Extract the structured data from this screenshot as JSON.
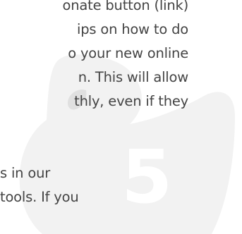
{
  "watermark": {
    "icon": "rubber-duck-icon",
    "step_number": "5",
    "fill_color": "#f2f2f2"
  },
  "paragraph1": {
    "lines": [
      "onate button (link)",
      "ips on how to do",
      "o your new online",
      "n. This will allow",
      "thly, even if they"
    ]
  },
  "paragraph2": {
    "lines": [
      "s in our",
      "tools. If you"
    ]
  }
}
